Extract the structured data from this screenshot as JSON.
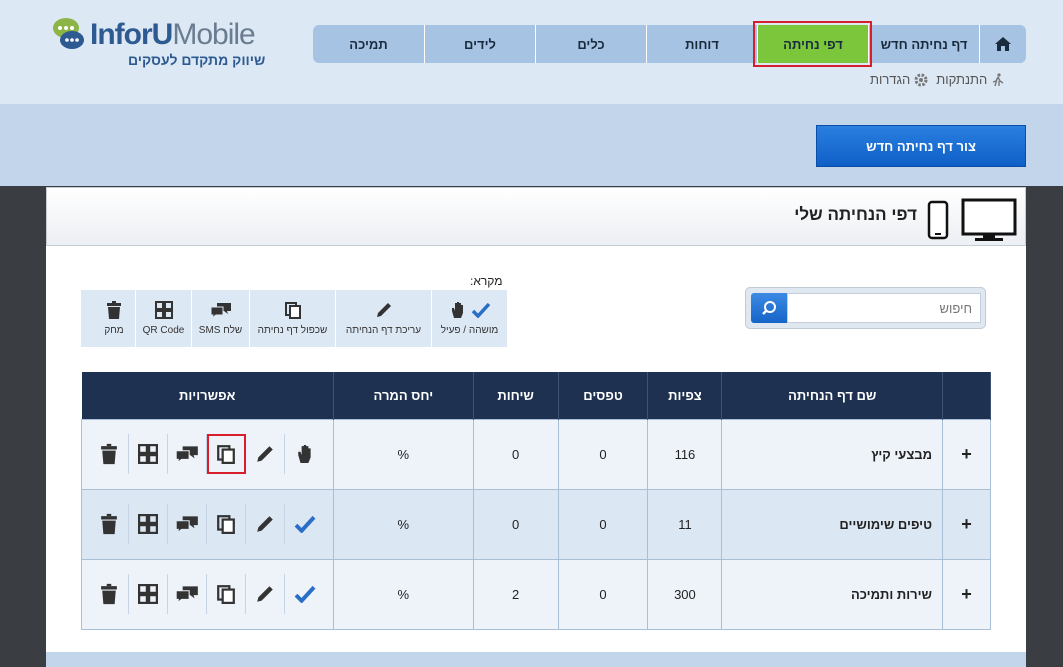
{
  "brand": {
    "logo_text": "InforUMobile",
    "tagline": "שיווק מתקדם לעסקים"
  },
  "nav": {
    "home_icon": "home-icon",
    "items": [
      {
        "label": "דף נחיתה חדש"
      },
      {
        "label": "דפי נחיתה",
        "active": true
      },
      {
        "label": "דוחות"
      },
      {
        "label": "כלים"
      },
      {
        "label": "לידים"
      },
      {
        "label": "תמיכה"
      }
    ]
  },
  "subnav": {
    "settings": "הגדרות",
    "logout": "התנתקות"
  },
  "actions": {
    "create_button": "צור דף נחיתה חדש"
  },
  "panel": {
    "title": "דפי הנחיתה שלי"
  },
  "search": {
    "placeholder": "חיפוש"
  },
  "legend": {
    "title": "מקרא:",
    "items": [
      {
        "icon": "hand-icon",
        "label": "מושהה / פעיל"
      },
      {
        "icon": "pencil-icon",
        "label": "עריכת דף הנחיתה"
      },
      {
        "icon": "copy-icon",
        "label": "שכפול דף נחיתה"
      },
      {
        "icon": "sms-icon",
        "label": "שלח SMS"
      },
      {
        "icon": "qr-icon",
        "label": "QR Code"
      },
      {
        "icon": "trash-icon",
        "label": "מחק"
      }
    ]
  },
  "table": {
    "headers": {
      "name": "שם דף הנחיתה",
      "views": "צפיות",
      "forms": "טפסים",
      "calls": "שיחות",
      "conversion": "יחס המרה",
      "options": "אפשרויות"
    },
    "rows": [
      {
        "name": "מבצעי קיץ",
        "views": "116",
        "forms": "0",
        "calls": "0",
        "conversion": "%",
        "status": "paused"
      },
      {
        "name": "טיפים שימושיים",
        "views": "11",
        "forms": "0",
        "calls": "0",
        "conversion": "%",
        "status": "active"
      },
      {
        "name": "שירות ותמיכה",
        "views": "300",
        "forms": "0",
        "calls": "2",
        "conversion": "%",
        "status": "active"
      }
    ],
    "expand_symbol": "+"
  },
  "colors": {
    "nav_bg": "#a7c3e3",
    "nav_active": "#7bc63b",
    "header_bg": "#dde8f5",
    "table_head": "#1f3150",
    "create_button": "#1565c8",
    "highlight": "#d81e2c"
  }
}
